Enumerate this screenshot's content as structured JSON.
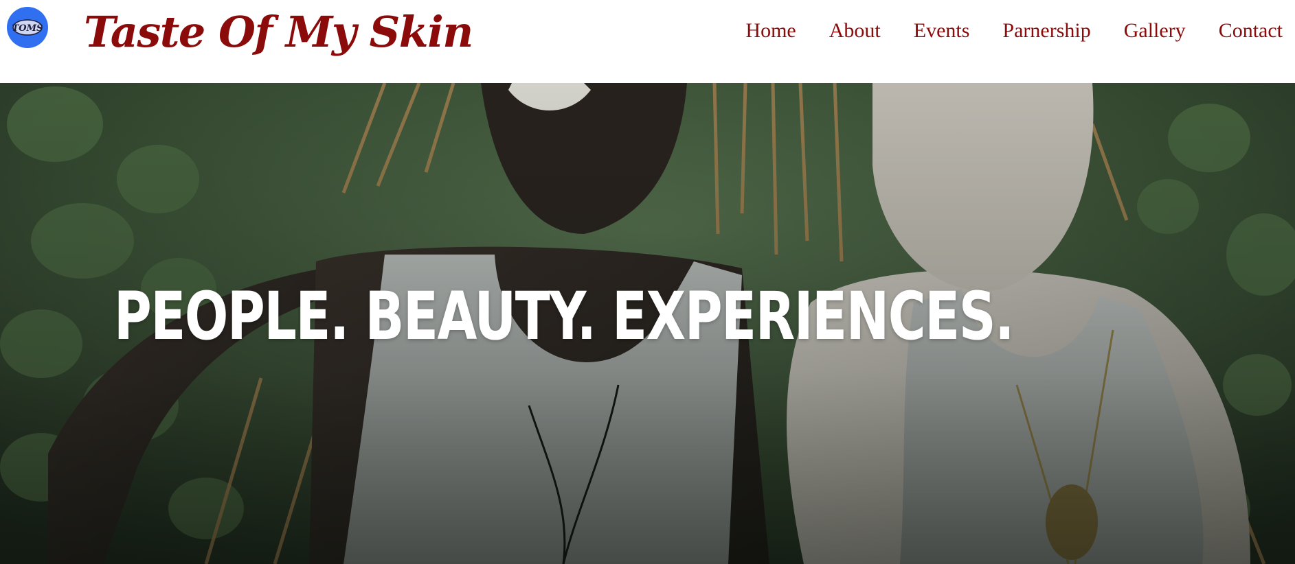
{
  "header": {
    "logo_text": "TOMS",
    "brand_title": "Taste Of My Skin",
    "nav": [
      {
        "label": "Home"
      },
      {
        "label": "About"
      },
      {
        "label": "Events"
      },
      {
        "label": "Parnership"
      },
      {
        "label": "Gallery"
      },
      {
        "label": "Contact"
      }
    ]
  },
  "hero": {
    "headline": "PEOPLE. BEAUTY. EXPERIENCES."
  },
  "colors": {
    "brand": "#8b0a0a",
    "logo_badge": "#2f6ff0",
    "headline": "#ffffff"
  },
  "icons": {
    "logo": "toms-logo-icon"
  }
}
